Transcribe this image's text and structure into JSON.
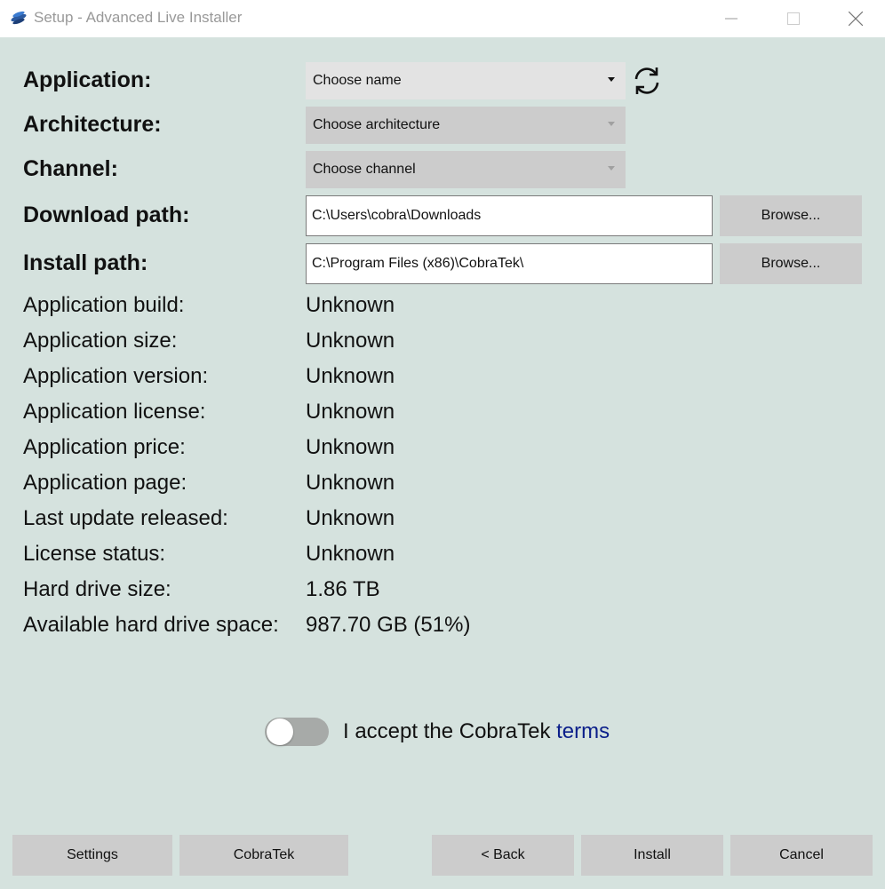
{
  "window": {
    "title": "Setup - Advanced Live Installer"
  },
  "form": {
    "application": {
      "label": "Application:",
      "value": "Choose name"
    },
    "architecture": {
      "label": "Architecture:",
      "value": "Choose architecture"
    },
    "channel": {
      "label": "Channel:",
      "value": "Choose channel"
    },
    "download_path": {
      "label": "Download path:",
      "value": "C:\\Users\\cobra\\Downloads",
      "browse": "Browse..."
    },
    "install_path": {
      "label": "Install path:",
      "value": "C:\\Program Files (x86)\\CobraTek\\",
      "browse": "Browse..."
    }
  },
  "info": [
    {
      "label": "Application build:",
      "value": "Unknown"
    },
    {
      "label": "Application size:",
      "value": "Unknown"
    },
    {
      "label": "Application version:",
      "value": "Unknown"
    },
    {
      "label": "Application license:",
      "value": "Unknown"
    },
    {
      "label": "Application price:",
      "value": "Unknown"
    },
    {
      "label": "Application page:",
      "value": "Unknown"
    },
    {
      "label": "Last update released:",
      "value": "Unknown"
    },
    {
      "label": "License status:",
      "value": "Unknown"
    },
    {
      "label": "Hard drive size:",
      "value": "1.86 TB"
    },
    {
      "label": "Available hard drive space:",
      "value": "987.70 GB (51%)"
    }
  ],
  "terms": {
    "accepted": false,
    "text": "I accept the CobraTek ",
    "link": "terms"
  },
  "buttons": {
    "settings": "Settings",
    "cobratek": "CobraTek",
    "back": "< Back",
    "install": "Install",
    "cancel": "Cancel"
  },
  "colors": {
    "background": "#d5e2de",
    "link": "#0b1f8a",
    "button": "#cccccc"
  }
}
